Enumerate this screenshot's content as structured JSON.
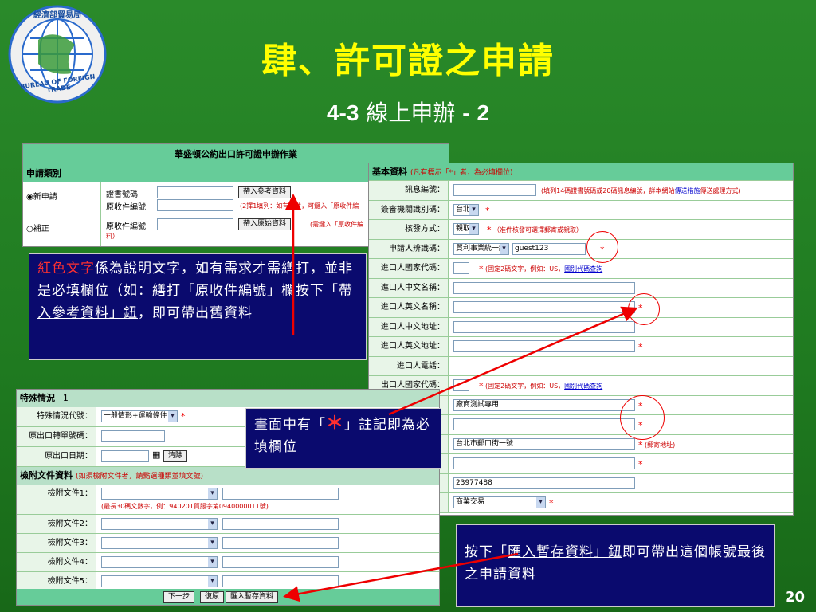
{
  "slide": {
    "title": "肆、許可證之申請",
    "subtitle_num": "4-3",
    "subtitle_text": "線上申辦",
    "subtitle_dash": "-",
    "subtitle_part": "2",
    "page_number": "20",
    "logo_top": "經濟部貿易局",
    "logo_ring": "BUREAU OF FOREIGN TRADE"
  },
  "win1": {
    "header": "華盛頓公約出口許可證申辦作業",
    "section": "申請類別",
    "radio_new": "新申請",
    "radio_fix": "補正",
    "cert_label": "證書號碼",
    "recv_label": "原收件編號",
    "recv_label2": "原收件編號",
    "btn_ref": "帶入參考資料",
    "btn_orig": "帶入原始資料",
    "note1": "(2擇1填列：如有證件，可鍵入「原收件編",
    "note2": "(需鍵入「原收件編",
    "note2b": "料）"
  },
  "win2": {
    "section": "基本資料",
    "section_note": "(凡有標示「*」者，為必填欄位)",
    "rows": [
      {
        "label": "訊息編號："
      },
      {
        "label": "簽審機關識別碼：",
        "value": "台北"
      },
      {
        "label": "核發方式：",
        "value": "親取",
        "note": "（准件核發可選擇郵寄或親取）"
      },
      {
        "label": "申請人辨識碼：",
        "value": "貿利事業統一編號",
        "value2": "guest123"
      },
      {
        "label": "進口人國家代碼：",
        "note": "(固定2碼文字，例如：US，",
        "link": "國別代碼查詢"
      },
      {
        "label": "進口人中文名稱："
      },
      {
        "label": "進口人英文名稱："
      },
      {
        "label": "進口人中文地址："
      },
      {
        "label": "進口人英文地址："
      },
      {
        "label": "進口人電話："
      },
      {
        "label": "出口人國家代碼：",
        "note": "(固定2碼文字，例如：US，",
        "link": "國別代碼查詢"
      },
      {
        "label": "",
        "value": "廠商測試專用"
      },
      {
        "label": ""
      },
      {
        "label": "",
        "value": "台北市郵口街一號",
        "note": "(郵寄地址)"
      },
      {
        "label": ""
      },
      {
        "label": "",
        "value": "23977488"
      },
      {
        "label": "",
        "value": "商業交易"
      }
    ],
    "msg_note": "(填列14碼證書號碼或20碼訊息編號，詳本網站",
    "msg_link": "傳送措施",
    "msg_note2": "傳送處理方式)"
  },
  "win3": {
    "section": "特殊情況",
    "section_num": "1",
    "special_label": "特殊情況代號：",
    "special_value": "一般情形+運輸條件",
    "orig_no_label": "原出口轉單號碼：",
    "orig_date_label": "原出口日期：",
    "clear_btn": "清除",
    "doc_section": "檢附文件資料",
    "doc_note": "(如須檢附文件者，請點選種類並填文號)",
    "doc_hint": "(最長30碼文數字，例：940201貿服字第0940000011號)",
    "docs": [
      "檢附文件1：",
      "檢附文件2：",
      "檢附文件3：",
      "檢附文件4：",
      "檢附文件5："
    ],
    "btn_next": "下一步",
    "btn_reset": "復原",
    "btn_import": "匯入暫存資料"
  },
  "callouts": {
    "c1_red": "紅色文字",
    "c1_a": "係為說明文字，如有需求才需繕打，並非是必填欄位（如：繕打",
    "c1_u": "「原收件編號」欄按下「帶入參考資料」鈕",
    "c1_b": "，即可帶出舊資料",
    "c2_a": "畫面中有「",
    "c2_star": "＊",
    "c2_b": "」註記即為必填欄位",
    "c3_a": "按下「",
    "c3_u": "匯入暫存資料」鈕",
    "c3_b": "即可帶出這個帳號最後之申請資料"
  },
  "colors": {
    "background": "#1f7a20",
    "title": "#ffff00",
    "callout_bg": "#0a0a6e",
    "form_green": "#66cc99",
    "arrow": "#e00000"
  }
}
